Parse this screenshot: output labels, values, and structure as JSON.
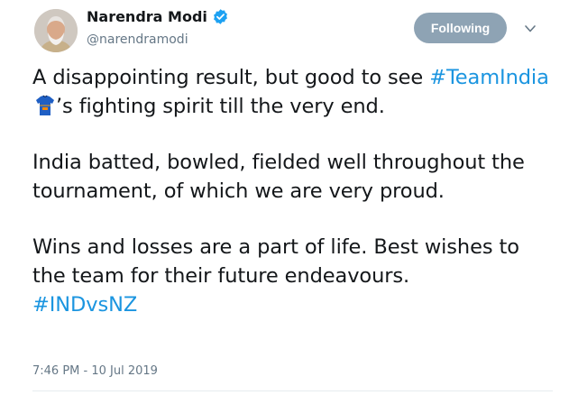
{
  "author": {
    "name": "Narendra Modi",
    "handle": "@narendramodi",
    "verified": true
  },
  "actions": {
    "follow_label": "Following",
    "more_icon": "chevron-down-icon"
  },
  "tweet": {
    "p1": {
      "text1": "A disappointing result, but good to see",
      "hashtag": "#TeamIndia",
      "emoji": "jersey-icon",
      "text2": "’s fighting spirit till the very end."
    },
    "p2": "India batted, bowled, fielded well throughout the tournament, of which we are very proud.",
    "p3": {
      "text": "Wins and losses are a part of life. Best wishes to the team for their future endeavours.",
      "hashtag": "#INDvsNZ"
    }
  },
  "timestamp": "7:46 PM - 10 Jul 2019",
  "colors": {
    "hashtag": "#1b95e0",
    "follow_button": "#8ea3b4",
    "verified": "#1da1f2",
    "secondary_text": "#657786"
  }
}
